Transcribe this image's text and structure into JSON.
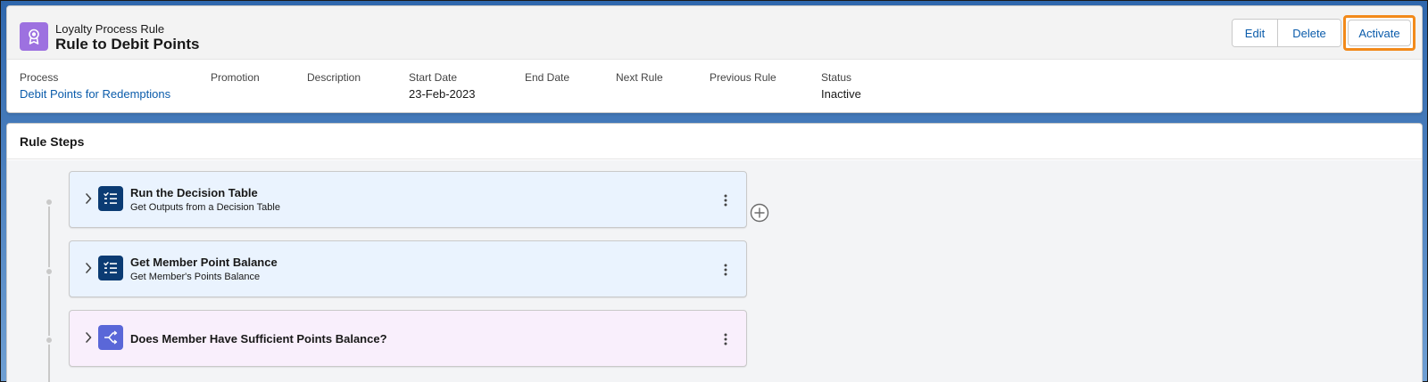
{
  "record": {
    "object_type": "Loyalty Process Rule",
    "title": "Rule to Debit Points",
    "icon": "award-ribbon-icon",
    "icon_color": "#9d71e0"
  },
  "actions": {
    "edit_label": "Edit",
    "delete_label": "Delete",
    "activate_label": "Activate",
    "highlight_color": "#f28a1b"
  },
  "fields": [
    {
      "label": "Process",
      "value": "Debit Points for Redemptions",
      "is_link": true
    },
    {
      "label": "Promotion",
      "value": ""
    },
    {
      "label": "Description",
      "value": ""
    },
    {
      "label": "Start Date",
      "value": "23-Feb-2023"
    },
    {
      "label": "End Date",
      "value": ""
    },
    {
      "label": "Next Rule",
      "value": ""
    },
    {
      "label": "Previous Rule",
      "value": ""
    },
    {
      "label": "Status",
      "value": "Inactive"
    }
  ],
  "steps_section": {
    "title": "Rule Steps",
    "steps": [
      {
        "title": "Run the Decision Table",
        "subtitle": "Get Outputs from a Decision Table",
        "icon": "decision-table-icon"
      },
      {
        "title": "Get Member Point Balance",
        "subtitle": "Get Member's Points Balance",
        "icon": "decision-table-icon"
      },
      {
        "title": "Does Member Have Sufficient Points Balance?",
        "subtitle": "",
        "icon": "decision-branch-icon"
      }
    ]
  },
  "colors": {
    "link": "#0b5cab",
    "step_icon_navy": "#0b3b73",
    "step_icon_violet": "#5a67d8",
    "step_bg_blue": "#eaf3fe",
    "step_bg_pink": "#f9effc"
  }
}
